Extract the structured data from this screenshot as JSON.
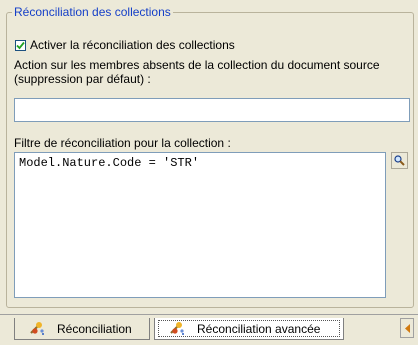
{
  "group": {
    "title": "Réconciliation des collections"
  },
  "checkbox": {
    "label": "Activer la réconciliation des collections",
    "checked": true
  },
  "action": {
    "label_line1": "Action sur les membres absents de la collection du document source",
    "label_line2": "(suppression par défaut) :",
    "value": ""
  },
  "filter": {
    "label": "Filtre de réconciliation pour la collection :",
    "value": "Model.Nature.Code = 'STR'",
    "zoom_icon": "magnifier-icon"
  },
  "tabs": [
    {
      "label": "Réconciliation",
      "icon": "wizard-icon",
      "active": false
    },
    {
      "label": "Réconciliation avancée",
      "icon": "wizard-icon",
      "active": true
    }
  ],
  "colors": {
    "title": "#1640c8",
    "panel": "#ece9d8",
    "border": "#7f9db9"
  }
}
